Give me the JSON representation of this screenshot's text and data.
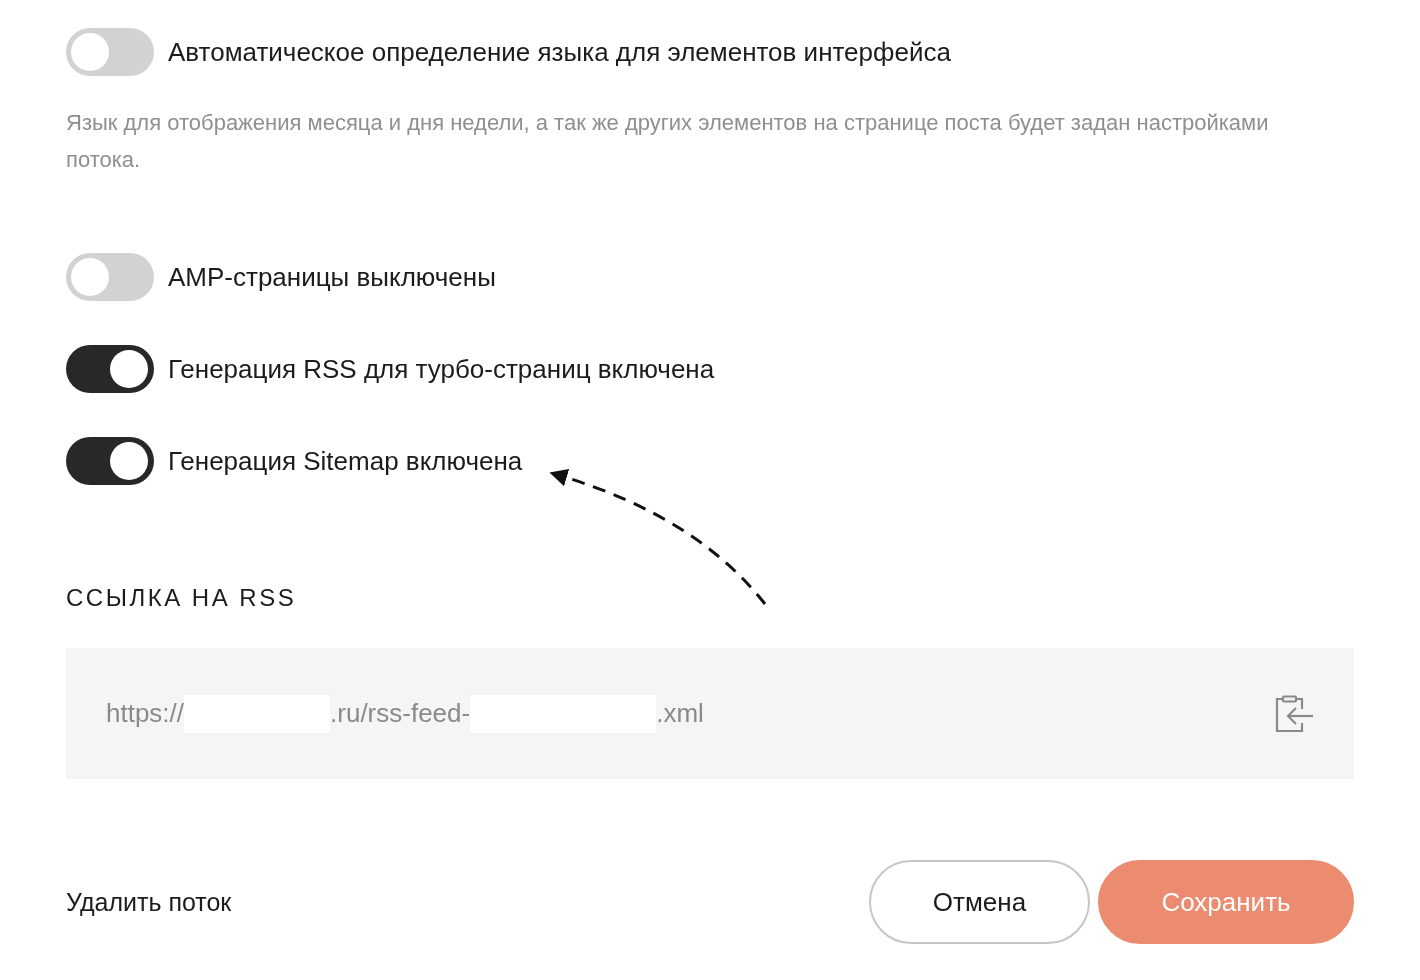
{
  "toggles": [
    {
      "label": "Автоматическое определение языка для элементов интерфейса",
      "on": false,
      "description": "Язык для отображения месяца и дня недели, а так же других элементов на странице поста будет задан настройками потока."
    },
    {
      "label": "AMP-страницы выключены",
      "on": false
    },
    {
      "label": "Генерация RSS для турбо-страниц включена",
      "on": true
    },
    {
      "label": "Генерация Sitemap включена",
      "on": true
    }
  ],
  "rss_link": {
    "heading": "ССЫЛКА НА RSS",
    "url_parts": [
      {
        "kind": "text",
        "text": "https://"
      },
      {
        "kind": "redacted"
      },
      {
        "kind": "text",
        "text": ".ru/rss-feed-"
      },
      {
        "kind": "redacted"
      },
      {
        "kind": "text",
        "text": ".xml"
      }
    ]
  },
  "footer": {
    "delete_link": "Удалить поток",
    "buttons": [
      {
        "kind": "secondary",
        "label": "Отмена"
      },
      {
        "kind": "primary",
        "label": "Сохранить"
      }
    ]
  }
}
